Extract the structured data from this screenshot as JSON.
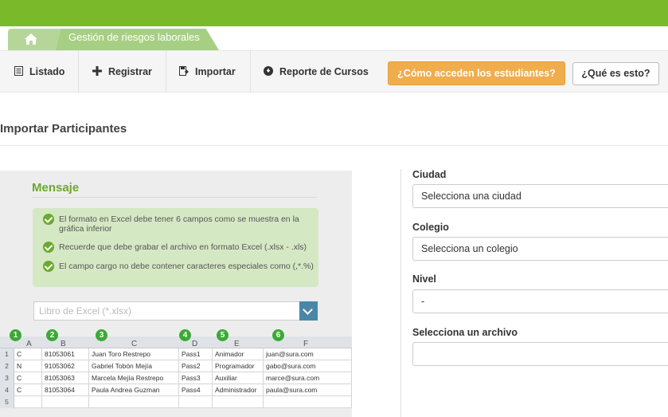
{
  "header": {
    "brand_color": "#7ab929",
    "breadcrumb": {
      "home_icon": "home-icon",
      "current": "Gestión de riesgos laborales"
    }
  },
  "nav": {
    "items": [
      {
        "label": "Listado",
        "icon": "list-icon"
      },
      {
        "label": "Registrar",
        "icon": "plus-icon"
      },
      {
        "label": "Importar",
        "icon": "import-icon"
      },
      {
        "label": "Reporte de Cursos",
        "icon": "info-circle-icon"
      }
    ],
    "how_students_access": "¿Cómo acceden los estudiantes?",
    "what_is_this": "¿Qué es esto?"
  },
  "page": {
    "title": "Importar Participantes"
  },
  "message": {
    "title": "Mensaje",
    "items": [
      "El formato en Excel debe tener 6 campos  como se muestra en la gráfica inferior",
      "Recuerde que debe grabar el archivo en formato Excel (.xlsx - .xls)",
      "El campo cargo no debe contener caracteres especiales como (,*.%)"
    ],
    "file_placeholder": "Libro de Excel (*.xlsx)"
  },
  "excel": {
    "markers": [
      "1",
      "2",
      "3",
      "4",
      "5",
      "6"
    ],
    "columns": [
      "A",
      "B",
      "C",
      "D",
      "E",
      "F"
    ],
    "row_numbers": [
      "1",
      "2",
      "3",
      "4",
      "5"
    ],
    "rows": [
      [
        "C",
        "81053061",
        "Juan Toro Restrepo",
        "Pass1",
        "Animador",
        "juan@sura.com"
      ],
      [
        "N",
        "91053062",
        "Gabriel Tobón Mejía",
        "Pass2",
        "Programador",
        "gabo@sura.com"
      ],
      [
        "C",
        "81053063",
        "Marcela Mejía Restrepo",
        "Pass3",
        "Auxiliar",
        "marce@sura.com"
      ],
      [
        "C",
        "81053064",
        "Paula Andrea Guzman",
        "Pass4",
        "Administrador",
        "paula@sura.com"
      ],
      [
        "",
        "",
        "",
        "",
        "",
        ""
      ]
    ]
  },
  "form": {
    "city_label": "Ciudad",
    "city_value": "Selecciona una ciudad",
    "school_label": "Colegio",
    "school_value": "Selecciona un colegio",
    "level_label": "Nivel",
    "level_value": "-",
    "file_label": "Selecciona un archivo",
    "file_value": ""
  }
}
